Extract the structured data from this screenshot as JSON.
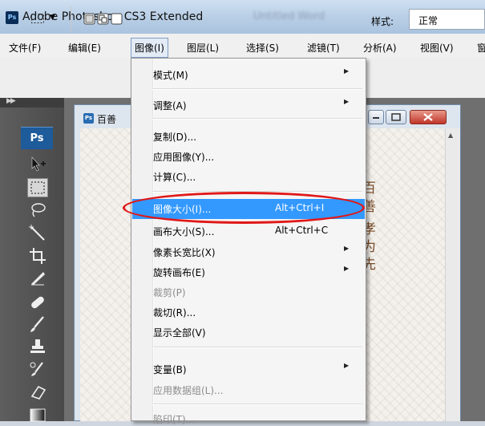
{
  "window": {
    "app_title": "Adobe Photoshop CS3 Extended",
    "logo_text": "Ps",
    "blurred_doc_name": "Untitled Word"
  },
  "menubar": {
    "items": [
      "文件(F)",
      "编辑(E)",
      "图像(I)",
      "图层(L)",
      "选择(S)",
      "滤镜(T)",
      "分析(A)",
      "视图(V)",
      "窗"
    ],
    "active": "图像(I)"
  },
  "options_bar": {
    "style_label": "样式:",
    "style_value": "正常"
  },
  "toolbox": {
    "logo": "Ps",
    "tools": [
      "move-tool",
      "marquee-tool",
      "lasso-tool",
      "magic-wand-tool",
      "crop-tool",
      "slice-tool",
      "healing-brush-tool",
      "brush-tool",
      "clone-stamp-tool",
      "history-brush-tool",
      "eraser-tool",
      "gradient-tool"
    ],
    "selected": "marquee-tool"
  },
  "document": {
    "title": "百善",
    "calligraphy": [
      "百",
      "善",
      "孝",
      "为",
      "先"
    ]
  },
  "image_menu": {
    "items": [
      {
        "label": "模式(M)",
        "submenu": true
      },
      {
        "label": "调整(A)",
        "submenu": true
      },
      {
        "label": "复制(D)..."
      },
      {
        "label": "应用图像(Y)..."
      },
      {
        "label": "计算(C)..."
      },
      {
        "label": "图像大小(I)...",
        "shortcut": "Alt+Ctrl+I",
        "highlighted": true
      },
      {
        "label": "画布大小(S)...",
        "shortcut": "Alt+Ctrl+C"
      },
      {
        "label": "像素长宽比(X)",
        "submenu": true
      },
      {
        "label": "旋转画布(E)",
        "submenu": true
      },
      {
        "label": "裁剪(P)",
        "disabled": true
      },
      {
        "label": "裁切(R)..."
      },
      {
        "label": "显示全部(V)"
      },
      {
        "label": "变量(B)",
        "submenu": true
      },
      {
        "label": "应用数据组(L)...",
        "disabled": true
      },
      {
        "label": "陷印(T)...",
        "disabled": true
      }
    ]
  },
  "colors": {
    "highlight": "#3399ff",
    "annotation_oval": "#e01818",
    "calligraphy": "#7a4c2a"
  }
}
